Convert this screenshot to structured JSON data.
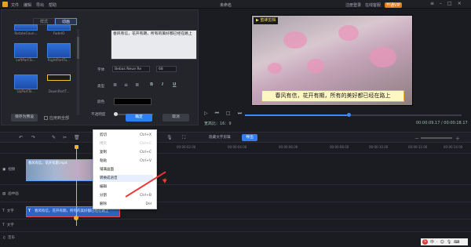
{
  "app": {
    "menu": [
      "文件",
      "编辑",
      "导出",
      "帮助"
    ],
    "window_title": "未命名",
    "top_right": [
      "注册登录",
      "在线客服",
      "开通VIP"
    ],
    "vip_color": "#e07b1c",
    "accent": "#2f7ef2"
  },
  "panel": {
    "tabs": [
      "样式",
      "动画"
    ],
    "thumbs": [
      {
        "label": "RotateCoun..."
      },
      {
        "label": "FadeIO"
      },
      {
        "label": "LeftPartTu..."
      },
      {
        "label": "RightPartTu..."
      },
      {
        "label": "UpPartTo..."
      },
      {
        "label": "DownPartT..."
      }
    ],
    "text": "春风有信，花开有期，所有的美好都已经在路上",
    "font_label": "字体",
    "font_value": "Bebas Neue Re",
    "font_size": "68",
    "type_label": "类型",
    "format_buttons": [
      "B",
      "I",
      "U"
    ],
    "color_label": "颜色",
    "opacity_label": "不透明度",
    "save_preset": "保存为预设",
    "apply_all": "应用到全部",
    "ok": "确定",
    "cancel": "取消"
  },
  "preview": {
    "banner": "▶ 蜜蜂剪辑",
    "subtitle": "春风有信，花开有期，所有的美好都已经在路上",
    "ratio_label": "宽高比：16：9",
    "time": "00:00:09.17 / 00:00:18.17",
    "progress": 0.47
  },
  "toolbar": {
    "split_label": "隐藏文字剪辑",
    "export": "导出"
  },
  "ruler": [
    "00:00:00.00",
    "00:00:02.00",
    "00:00:04.00",
    "00:00:06.00",
    "00:00:08.00",
    "00:00:10.00",
    "00:00:12.00",
    "00:00:14.00"
  ],
  "tracks": [
    {
      "label": "视频"
    },
    {
      "label": "画中画"
    },
    {
      "label": "文字"
    },
    {
      "label": "文字"
    },
    {
      "label": "音乐"
    }
  ],
  "clips": {
    "video_label": "春风有信，花开有期.mp4",
    "text_label": "春风有信，花开有期，所有的美好都已经在路上"
  },
  "context_menu": [
    {
      "label": "剪切",
      "key": "Ctrl+X",
      "disabled": false
    },
    {
      "label": "拷贝",
      "key": "Ctrl+C",
      "disabled": true
    },
    {
      "label": "复制",
      "key": "Ctrl+C",
      "disabled": false
    },
    {
      "label": "粘贴",
      "key": "Ctrl+V",
      "disabled": false
    },
    {
      "label": "铺满画面",
      "key": "",
      "disabled": false
    },
    {
      "label": "转换成语音",
      "key": "",
      "disabled": false,
      "highlight": true
    },
    {
      "label": "编辑",
      "key": "",
      "disabled": false
    },
    {
      "label": "分割",
      "key": "Ctrl+B",
      "disabled": false
    },
    {
      "label": "删除",
      "key": "Del",
      "disabled": false
    }
  ]
}
